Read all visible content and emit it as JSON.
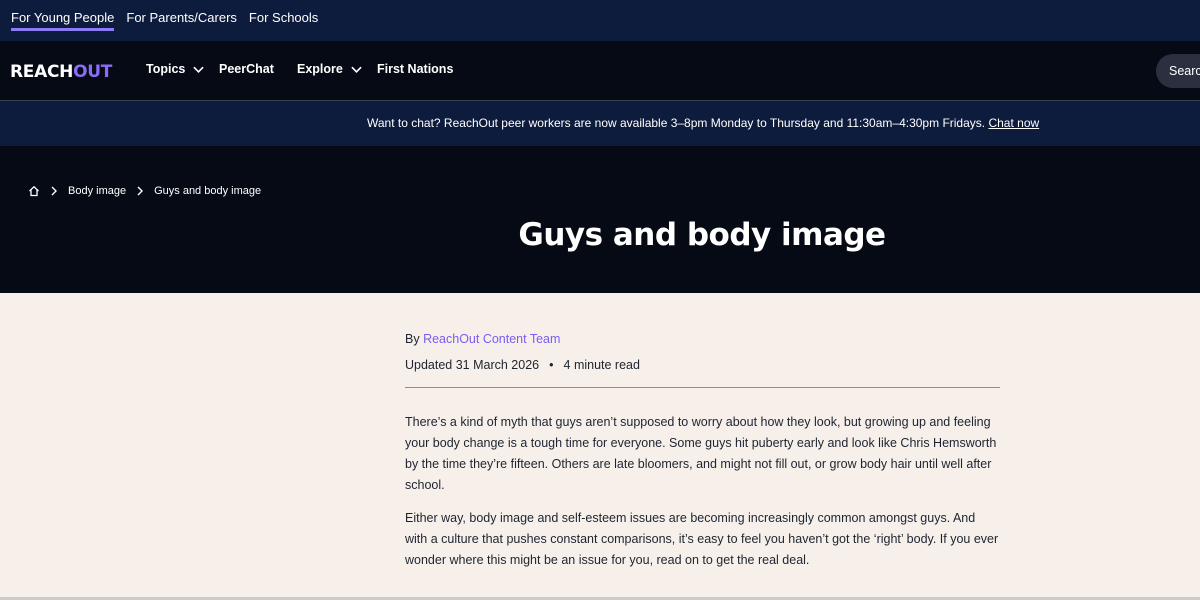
{
  "audience_tabs": [
    {
      "label": "For Young People",
      "active": true
    },
    {
      "label": "For Parents/Carers",
      "active": false
    },
    {
      "label": "For Schools",
      "active": false
    }
  ],
  "nav": {
    "logo_text_main": "REACH",
    "logo_text_accent": "OUT",
    "items": [
      {
        "label": "Topics",
        "has_dropdown": true
      },
      {
        "label": "PeerChat",
        "has_dropdown": false
      },
      {
        "label": "Explore",
        "has_dropdown": true
      },
      {
        "label": "First Nations",
        "has_dropdown": false
      }
    ],
    "search_label": "Search"
  },
  "banner": {
    "message": "Want to chat? ReachOut peer workers are now available 3–8pm Monday to Thursday and 11:30am–4:30pm Fridays.",
    "link_label": "Chat now"
  },
  "breadcrumb": {
    "home_icon": "home-icon",
    "items": [
      "Body image",
      "Guys and body image"
    ]
  },
  "page": {
    "title": "Guys and body image"
  },
  "article": {
    "by_prefix": "By",
    "author": "ReachOut Content Team",
    "updated": "Updated 31 March 2026",
    "separator": "•",
    "read_time": "4 minute read",
    "paragraphs": [
      "There’s a kind of myth that guys aren’t supposed to worry about how they look, but growing up and feeling your body change is a tough time for everyone. Some guys hit puberty early and look like Chris Hemsworth by the time they’re fifteen. Others are late bloomers, and might not fill out, or grow body hair until well after school.",
      "Either way, body image and self-esteem issues are becoming increasingly common amongst guys. And with a culture that pushes constant comparisons, it’s easy to feel you haven’t got the ‘right’ body. If you ever wonder where this might be an issue for you, read on to get the real deal."
    ]
  },
  "colors": {
    "accent": "#8b7cf6",
    "navy": "#0d1b3d",
    "black": "#050a14",
    "page_bg": "#f7f0ea"
  }
}
